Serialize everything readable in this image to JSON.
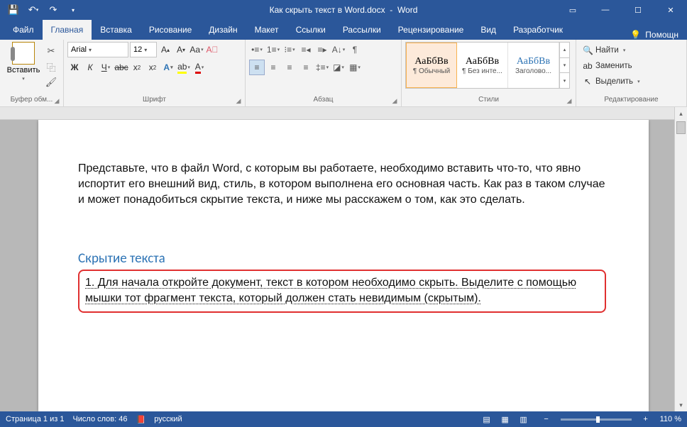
{
  "title": {
    "doc": "Как скрыть текст в Word.docx",
    "app": "Word"
  },
  "tabs": {
    "file": "Файл",
    "home": "Главная",
    "insert": "Вставка",
    "draw": "Рисование",
    "design": "Дизайн",
    "layout": "Макет",
    "references": "Ссылки",
    "mailings": "Рассылки",
    "review": "Рецензирование",
    "view": "Вид",
    "developer": "Разработчик",
    "help": "Помощн"
  },
  "ribbon": {
    "clipboard": {
      "paste": "Вставить",
      "label": "Буфер обм..."
    },
    "font": {
      "name": "Arial",
      "size": "12",
      "label": "Шрифт",
      "bold": "Ж",
      "italic": "К",
      "underline": "Ч"
    },
    "paragraph": {
      "label": "Абзац"
    },
    "styles": {
      "label": "Стили",
      "preview": "АаБбВв",
      "items": [
        "¶ Обычный",
        "¶ Без инте...",
        "Заголово..."
      ]
    },
    "editing": {
      "label": "Редактирование",
      "find": "Найти",
      "replace": "Заменить",
      "select": "Выделить"
    }
  },
  "document": {
    "para1": "Представьте, что в файл Word, с которым вы работаете, необходимо вставить что-то, что явно испортит его внешний вид, стиль, в котором выполнена его основная часть. Как раз в таком случае и может понадобиться скрытие текста, и ниже мы расскажем о том, как это сделать.",
    "heading": "Скрытие текста",
    "hidden": "1. Для начала откройте документ, текст в котором необходимо скрыть. Выделите с помощью мышки тот фрагмент текста, который должен стать невидимым (скрытым)."
  },
  "status": {
    "page": "Страница 1 из 1",
    "words": "Число слов: 46",
    "lang": "русский",
    "zoom": "110 %"
  }
}
